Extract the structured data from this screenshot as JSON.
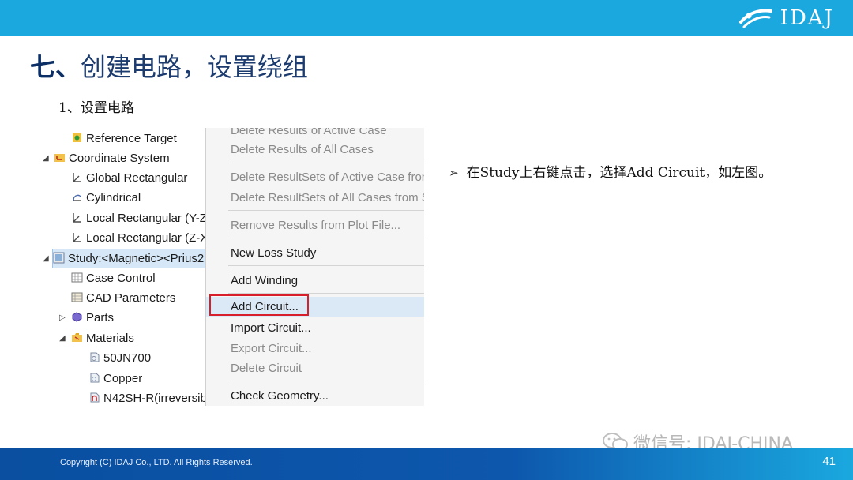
{
  "header": {
    "logo_text": "IDAJ"
  },
  "title": {
    "number": "七、",
    "text": "创建电路，设置绕组"
  },
  "subtitle": "1、设置电路",
  "tree": {
    "items": [
      {
        "label": "Reference Target",
        "icon": "target-icon"
      },
      {
        "label": "Coordinate System",
        "icon": "coordinate-system-icon"
      },
      {
        "label": "Global Rectangular",
        "icon": "axis-icon"
      },
      {
        "label": "Cylindrical",
        "icon": "cylindrical-axis-icon"
      },
      {
        "label": "Local Rectangular (Y-Z-",
        "icon": "axis-icon"
      },
      {
        "label": "Local Rectangular (Z-X-",
        "icon": "axis-icon"
      },
      {
        "label": "Study:<Magnetic><Prius2",
        "icon": "study-icon"
      },
      {
        "label": "Case Control",
        "icon": "table-icon"
      },
      {
        "label": "CAD Parameters",
        "icon": "table-icon"
      },
      {
        "label": "Parts",
        "icon": "parts-icon"
      },
      {
        "label": "Materials",
        "icon": "folder-icon"
      },
      {
        "label": "50JN700",
        "icon": "material-icon"
      },
      {
        "label": "Copper",
        "icon": "material-icon"
      },
      {
        "label": "N42SH-R(irreversib",
        "icon": "magnet-material-icon"
      }
    ]
  },
  "context_menu": {
    "items": [
      {
        "label": "Delete Results of Active Case",
        "enabled": false
      },
      {
        "label": "Delete Results of All Cases",
        "enabled": false
      },
      {
        "label": "Delete ResultSets of Active Case from",
        "enabled": false
      },
      {
        "label": "Delete ResultSets of All Cases from Stu",
        "enabled": false
      },
      {
        "label": "Remove Results from Plot File...",
        "enabled": false
      },
      {
        "label": "New Loss Study",
        "enabled": true
      },
      {
        "label": "Add Winding",
        "enabled": true
      },
      {
        "label": "Add Circuit...",
        "enabled": true
      },
      {
        "label": "Import Circuit...",
        "enabled": true
      },
      {
        "label": "Export Circuit...",
        "enabled": false
      },
      {
        "label": "Delete Circuit",
        "enabled": false
      },
      {
        "label": "Check Geometry...",
        "enabled": true
      }
    ]
  },
  "note": "在Study上右键点击，选择Add Circuit，如左图。",
  "watermark": "微信号: IDAJ-CHINA",
  "footer": {
    "copyright": "Copyright (C) IDAJ Co., LTD. All Rights Reserved.",
    "page": "41"
  },
  "colors": {
    "header": "#1aa8df",
    "footer": "#0a4fa0",
    "highlight": "#d81e2a",
    "title": "#1c3b6e"
  }
}
